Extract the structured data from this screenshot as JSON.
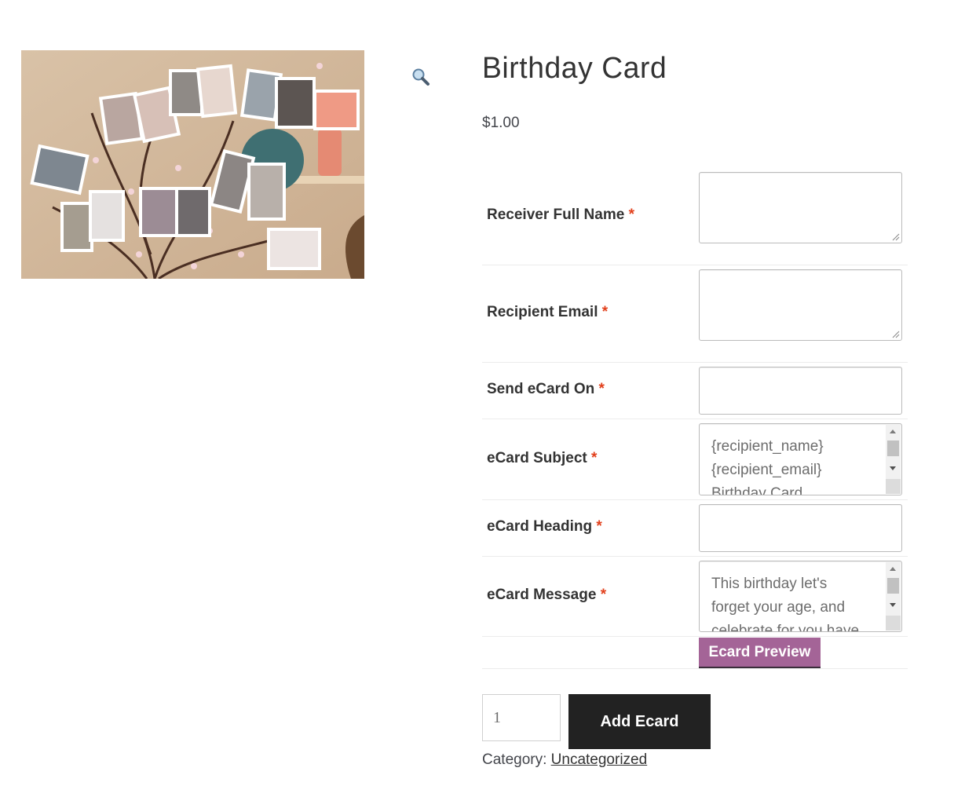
{
  "product": {
    "title": "Birthday Card",
    "price": "$1.00",
    "image_alt": "photos clipped to blossom branches"
  },
  "form": {
    "receiver_name_label": "Receiver Full Name",
    "recipient_email_label": "Recipient Email",
    "send_on_label": "Send eCard On",
    "subject_label": "eCard Subject",
    "subject_value": "{recipient_name}\n{recipient_email}\nBirthday Card",
    "heading_label": "eCard Heading",
    "message_label": "eCard Message",
    "message_value": "This birthday let's\nforget your age, and\ncelebrate for you have",
    "required_mark": "*",
    "preview_button": "Ecard Preview"
  },
  "cart": {
    "quantity": "1",
    "add_button": "Add Ecard"
  },
  "meta": {
    "category_label": "Category:",
    "category_link": "Uncategorized"
  },
  "colors": {
    "accent_purple": "#a46497",
    "button_dark": "#222222",
    "required_red": "#e2401c"
  },
  "icons": {
    "zoom": "magnifier-icon"
  }
}
